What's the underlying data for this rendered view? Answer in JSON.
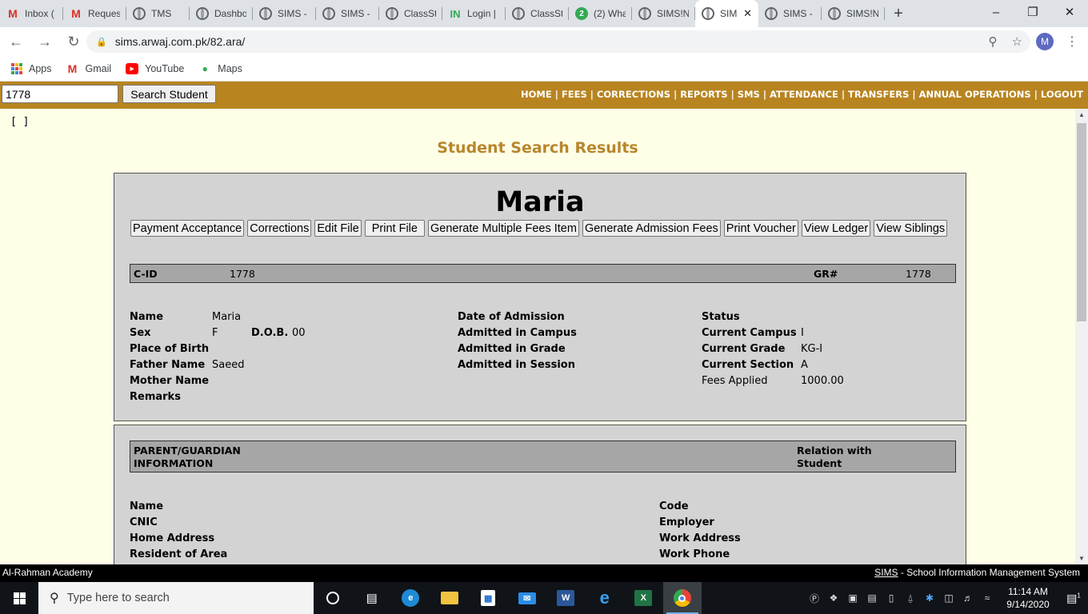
{
  "browser": {
    "tabs": [
      {
        "title": "Inbox (",
        "icon": "gmail-icon",
        "active": false
      },
      {
        "title": "Reques",
        "icon": "gmail-icon",
        "active": false
      },
      {
        "title": "TMS",
        "icon": "globe-icon",
        "active": false
      },
      {
        "title": "Dashbo",
        "icon": "globe-icon",
        "active": false
      },
      {
        "title": "SIMS -",
        "icon": "globe-icon",
        "active": false
      },
      {
        "title": "SIMS -",
        "icon": "globe-icon",
        "active": false
      },
      {
        "title": "ClassSt",
        "icon": "globe-icon",
        "active": false
      },
      {
        "title": "Login |",
        "icon": "login-icon",
        "active": false
      },
      {
        "title": "ClassSt",
        "icon": "globe-icon",
        "active": false
      },
      {
        "title": "(2) Wha",
        "icon": "whatsapp-icon",
        "active": false
      },
      {
        "title": "SIMS!N",
        "icon": "globe-icon",
        "active": false
      },
      {
        "title": "SIM",
        "icon": "globe-icon",
        "active": true
      },
      {
        "title": "SIMS -",
        "icon": "globe-icon",
        "active": false
      },
      {
        "title": "SIMS!N",
        "icon": "globe-icon",
        "active": false
      }
    ],
    "url": "sims.arwaj.com.pk/82.ara/",
    "profile_initial": "M",
    "bookmarks": [
      {
        "label": "Apps",
        "icon": "apps-grid-icon"
      },
      {
        "label": "Gmail",
        "icon": "gmail-icon"
      },
      {
        "label": "YouTube",
        "icon": "youtube-icon"
      },
      {
        "label": "Maps",
        "icon": "maps-pin-icon"
      }
    ]
  },
  "sims": {
    "search_value": "1778",
    "search_button": "Search Student",
    "nav": [
      "HOME",
      "FEES",
      "CORRECTIONS",
      "REPORTS",
      "SMS",
      "ATTENDANCE",
      "TRANSFERS",
      "ANNUAL OPERATIONS",
      "LOGOUT"
    ],
    "brackets": "[ ]",
    "page_title": "Student Search Results",
    "student_name": "Maria",
    "actions": [
      "Payment Acceptance",
      "Corrections",
      "Edit File",
      "Print File",
      "Generate Multiple Fees Item",
      "Generate Admission Fees",
      "Print Voucher",
      "View Ledger",
      "View Siblings"
    ],
    "cid_label": "C-ID",
    "cid_value": "1778",
    "gr_label": "GR#",
    "gr_value": "1778",
    "col1": {
      "name_label": "Name",
      "name_value": "Maria",
      "sex_label": "Sex",
      "sex_value": "F",
      "dob_label": "D.O.B.",
      "dob_value": "00",
      "pob_label": "Place of Birth",
      "father_label": "Father Name",
      "father_value": "Saeed",
      "mother_label": "Mother Name",
      "remarks_label": "Remarks"
    },
    "col2": {
      "doa_label": "Date of Admission",
      "campus_label": "Admitted in Campus",
      "grade_label": "Admitted in Grade",
      "session_label": "Admitted in Session"
    },
    "col3": {
      "status_label": "Status",
      "cur_campus_label": "Current Campus",
      "cur_campus_value": "I",
      "cur_grade_label": "Current Grade",
      "cur_grade_value": "KG-I",
      "cur_section_label": "Current Section",
      "cur_section_value": "A",
      "fees_label": "Fees Applied",
      "fees_value": "1000.00"
    },
    "guardian": {
      "header_left": "PARENT/GUARDIAN INFORMATION",
      "header_right": "Relation with Student",
      "name_label": "Name",
      "cnic_label": "CNIC",
      "home_label": "Home Address",
      "area_label": "Resident of Area",
      "code_label": "Code",
      "employer_label": "Employer",
      "work_address_label": "Work Address",
      "work_phone_label": "Work Phone"
    },
    "footer_left": "Al-Rahman Academy",
    "footer_brand": "SIMS",
    "footer_right": " - School Information Management System"
  },
  "taskbar": {
    "search_placeholder": "Type here to search",
    "time": "11:14 AM",
    "date": "9/14/2020",
    "notification_count": "1"
  }
}
